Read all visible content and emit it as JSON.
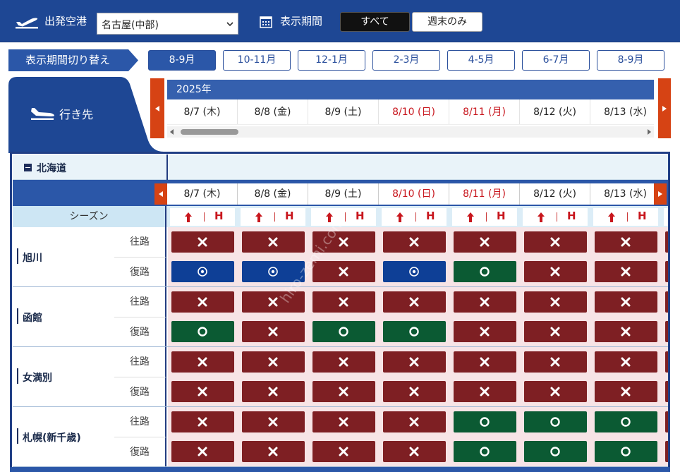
{
  "top": {
    "origin_label": "出発空港",
    "origin_value": "名古屋(中部)",
    "period_label": "表示期間",
    "btn_all": "すべて",
    "btn_weekend": "週末のみ"
  },
  "period_switch": {
    "label": "表示期間切り替え",
    "tabs": [
      "8-9月",
      "10-11月",
      "12-1月",
      "2-3月",
      "4-5月",
      "6-7月",
      "8-9月"
    ],
    "active_index": 0
  },
  "destination_label": "行き先",
  "year": "2025年",
  "dates": [
    {
      "label": "8/7 (木)",
      "holiday": false
    },
    {
      "label": "8/8 (金)",
      "holiday": false
    },
    {
      "label": "8/9 (土)",
      "holiday": false
    },
    {
      "label": "8/10 (日)",
      "holiday": true
    },
    {
      "label": "8/11 (月)",
      "holiday": true
    },
    {
      "label": "8/12 (火)",
      "holiday": false
    },
    {
      "label": "8/13 (水)",
      "holiday": false
    }
  ],
  "region": "北海道",
  "season_label": "シーズン",
  "season_h": "H",
  "rows": [
    {
      "name": "旭川",
      "outbound_label": "往路",
      "return_label": "復路",
      "outbound": [
        "x",
        "x",
        "x",
        "x",
        "x",
        "x",
        "x"
      ],
      "return": [
        "d",
        "d",
        "x",
        "d",
        "o",
        "x",
        "x"
      ]
    },
    {
      "name": "函館",
      "outbound_label": "往路",
      "return_label": "復路",
      "outbound": [
        "x",
        "x",
        "x",
        "x",
        "x",
        "x",
        "x"
      ],
      "return": [
        "o",
        "x",
        "o",
        "o",
        "x",
        "x",
        "x"
      ]
    },
    {
      "name": "女満別",
      "outbound_label": "往路",
      "return_label": "復路",
      "outbound": [
        "x",
        "x",
        "x",
        "x",
        "x",
        "x",
        "x"
      ],
      "return": [
        "x",
        "x",
        "x",
        "x",
        "x",
        "x",
        "x"
      ]
    },
    {
      "name": "札幌(新千歳)",
      "outbound_label": "往路",
      "return_label": "復路",
      "outbound": [
        "x",
        "x",
        "x",
        "x",
        "o",
        "o",
        "o"
      ],
      "return": [
        "x",
        "x",
        "x",
        "x",
        "o",
        "o",
        "o"
      ]
    }
  ],
  "colors": {
    "x": "#7e1f23",
    "o": "#0b5a33",
    "d": "#0e3f96",
    "nav": "#d64314",
    "brand": "#1e4794"
  },
  "watermark": "hiro-zemi.com"
}
